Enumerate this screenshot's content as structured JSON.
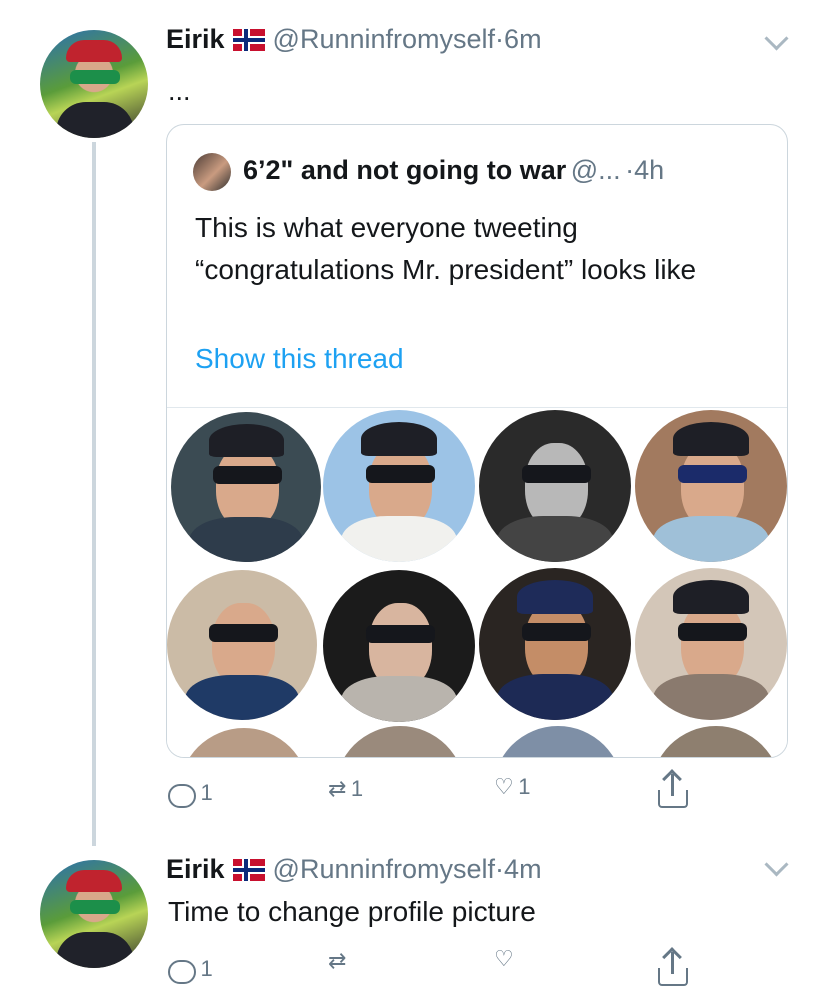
{
  "tweet1": {
    "name": "Eirik",
    "handle": "@Runninfromyself",
    "dot": "·",
    "time": "6m",
    "text": "...",
    "actions": {
      "reply_count": "1",
      "retweet_count": "1",
      "like_count": "1"
    }
  },
  "quoted": {
    "name": "6’2\" and not going to war",
    "handle": "@...",
    "dot": "·",
    "time": "4h",
    "text": "This is what everyone tweeting “congratulations Mr. president” looks like",
    "link": "Show this thread"
  },
  "tweet2": {
    "name": "Eirik",
    "handle": "@Runninfromyself",
    "dot": "·",
    "time": "4m",
    "text": "Time to change profile picture",
    "actions": {
      "reply_count": "1",
      "retweet_count": "",
      "like_count": ""
    }
  },
  "colors": {
    "link": "#1da1f2",
    "secondary_text": "#657786",
    "border": "#ccd6dd"
  },
  "icons": [
    "flag-norway-icon",
    "chevron-down-icon",
    "reply-icon",
    "retweet-icon",
    "heart-icon",
    "share-icon"
  ]
}
